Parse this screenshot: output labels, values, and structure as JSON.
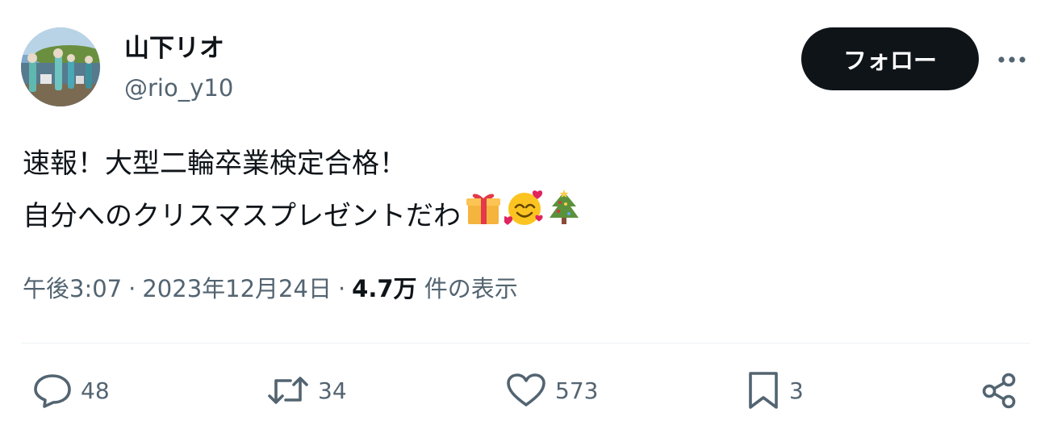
{
  "user": {
    "name": "山下リオ",
    "handle": "@rio_y10"
  },
  "header": {
    "follow_label": "フォロー",
    "more_label": "···"
  },
  "tweet": {
    "line1": "速報！大型二輪卒業検定合格！",
    "line2": "自分へのクリスマスプレゼントだわ",
    "emojis": [
      "🎁",
      "🥰",
      "🎄"
    ]
  },
  "meta": {
    "time": "午後3:07",
    "separator": "·",
    "date": "2023年12月24日",
    "views_count": "4.7万",
    "views_label": "件の表示"
  },
  "actions": {
    "reply_count": "48",
    "retweet_count": "34",
    "like_count": "573",
    "bookmark_count": "3"
  },
  "colors": {
    "text": "#0f1419",
    "secondary": "#536471",
    "follow_bg": "#0f1419",
    "divider": "#eff3f4"
  },
  "icons": [
    "reply-icon",
    "retweet-icon",
    "like-icon",
    "bookmark-icon",
    "share-icon",
    "more-icon"
  ]
}
